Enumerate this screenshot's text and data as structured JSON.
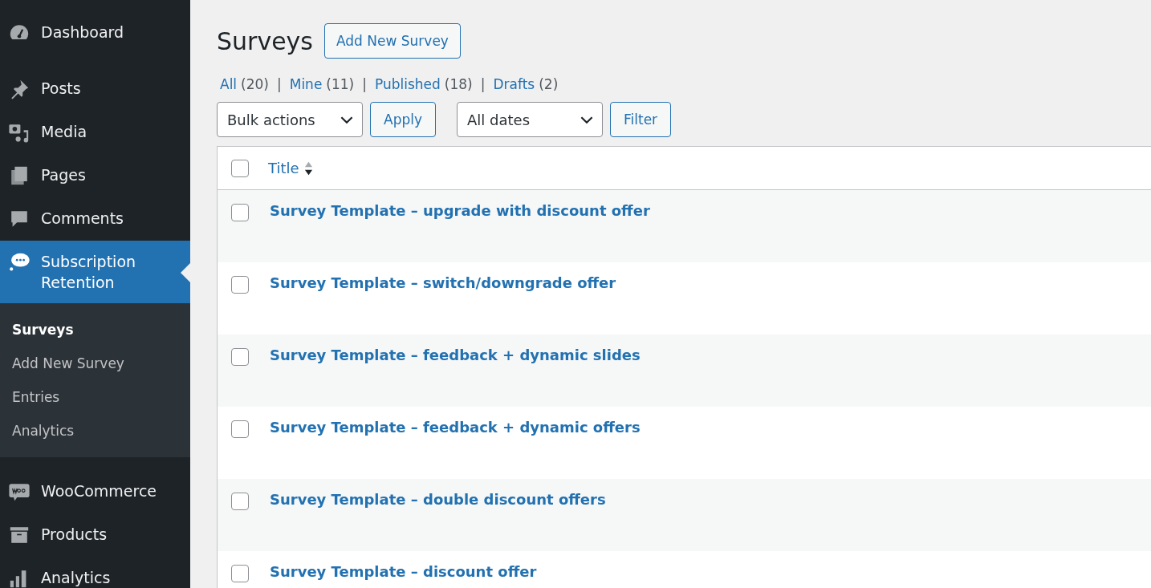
{
  "sidebar": {
    "items": [
      {
        "label": "Dashboard",
        "selected": false
      },
      {
        "label": "Posts",
        "selected": false
      },
      {
        "label": "Media",
        "selected": false
      },
      {
        "label": "Pages",
        "selected": false
      },
      {
        "label": "Comments",
        "selected": false
      },
      {
        "label": "Subscription Retention",
        "selected": true,
        "children": [
          {
            "label": "Surveys",
            "selected": true
          },
          {
            "label": "Add New Survey",
            "selected": false
          },
          {
            "label": "Entries",
            "selected": false
          },
          {
            "label": "Analytics",
            "selected": false
          }
        ]
      },
      {
        "label": "WooCommerce",
        "selected": false
      },
      {
        "label": "Products",
        "selected": false
      },
      {
        "label": "Analytics",
        "selected": false
      }
    ]
  },
  "page": {
    "title": "Surveys",
    "add_button": "Add New Survey"
  },
  "views": [
    {
      "label": "All",
      "count": "(20)"
    },
    {
      "label": "Mine",
      "count": "(11)"
    },
    {
      "label": "Published",
      "count": "(18)"
    },
    {
      "label": "Drafts",
      "count": "(2)"
    }
  ],
  "views_separator": "|",
  "bulk_actions": {
    "value": "Bulk actions",
    "button": "Apply"
  },
  "date_filter": {
    "value": "All dates",
    "button": "Filter"
  },
  "table": {
    "columns": [
      {
        "label": "Title"
      }
    ],
    "header_checked": false,
    "rows": [
      {
        "title": "Survey Template – upgrade with discount offer",
        "checked": false
      },
      {
        "title": "Survey Template – switch/downgrade offer",
        "checked": false
      },
      {
        "title": "Survey Template – feedback + dynamic slides",
        "checked": false
      },
      {
        "title": "Survey Template – feedback + dynamic offers",
        "checked": false
      },
      {
        "title": "Survey Template – double discount offers",
        "checked": false
      },
      {
        "title": "Survey Template – discount offer",
        "checked": false
      }
    ]
  }
}
